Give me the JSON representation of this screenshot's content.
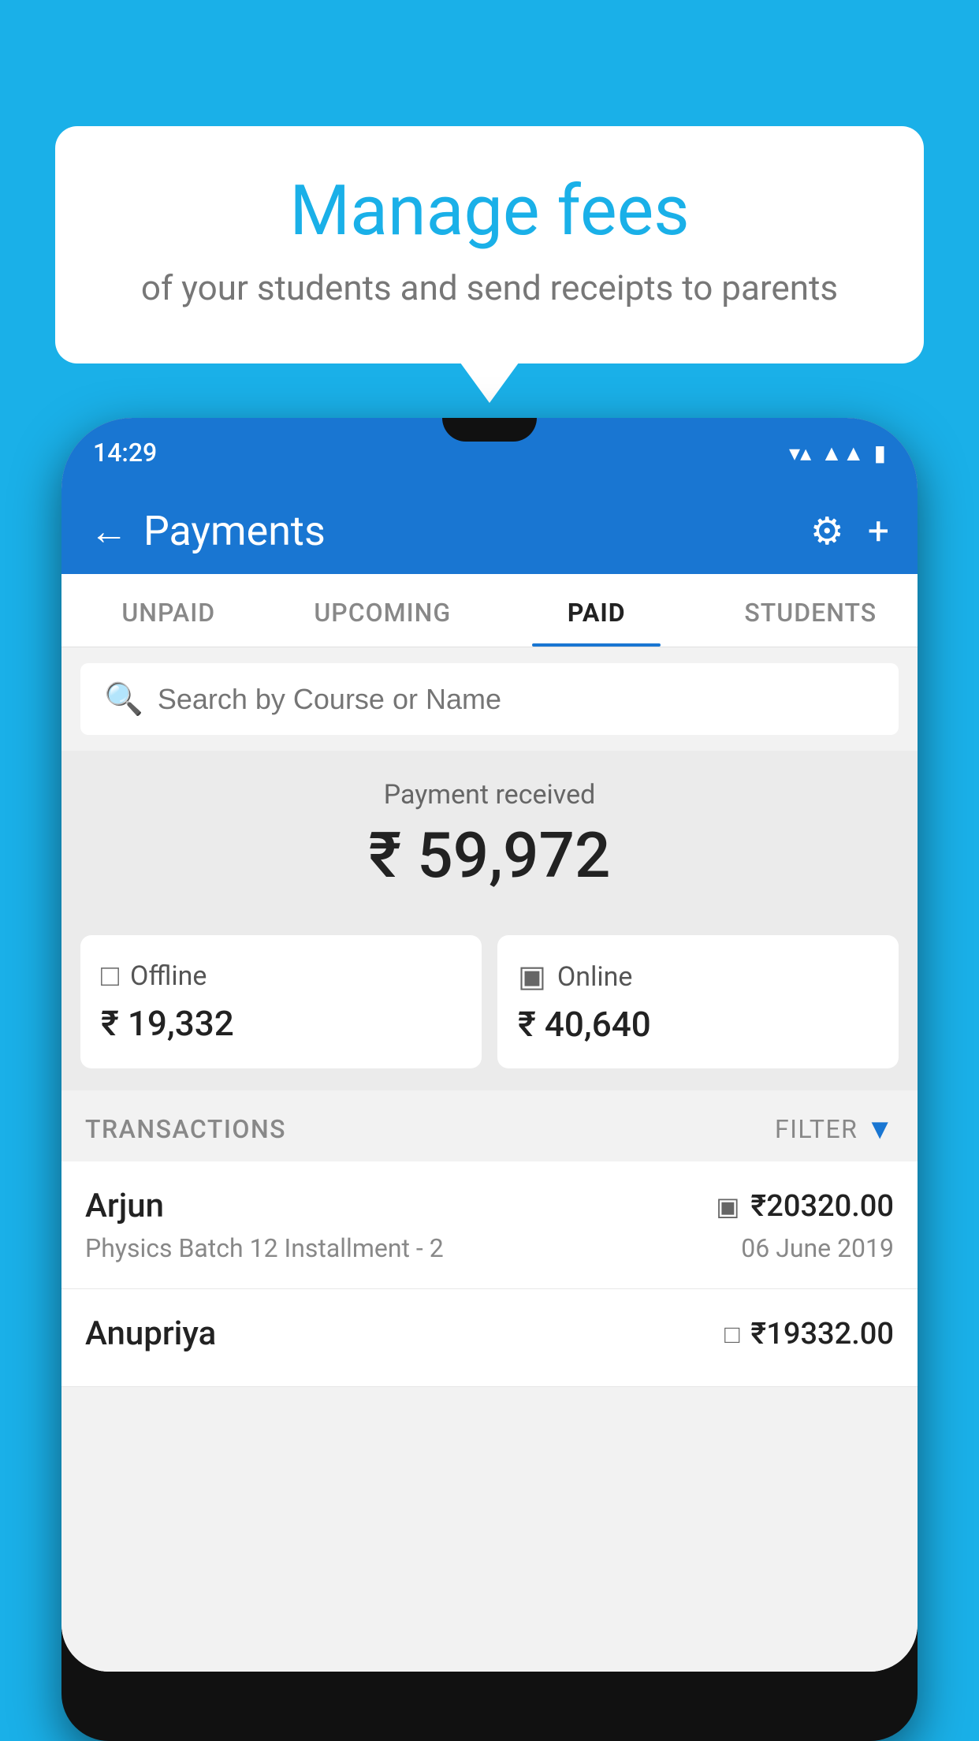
{
  "background_color": "#1ab0e8",
  "bubble": {
    "title": "Manage fees",
    "subtitle": "of your students and send receipts to parents"
  },
  "phone": {
    "status_time": "14:29",
    "header": {
      "title": "Payments",
      "back_label": "←",
      "gear_label": "⚙",
      "plus_label": "+"
    },
    "tabs": [
      {
        "label": "UNPAID",
        "active": false
      },
      {
        "label": "UPCOMING",
        "active": false
      },
      {
        "label": "PAID",
        "active": true
      },
      {
        "label": "STUDENTS",
        "active": false
      }
    ],
    "search": {
      "placeholder": "Search by Course or Name"
    },
    "payment_summary": {
      "label": "Payment received",
      "amount": "₹ 59,972",
      "offline_label": "Offline",
      "offline_amount": "₹ 19,332",
      "online_label": "Online",
      "online_amount": "₹ 40,640"
    },
    "transactions": {
      "header": "TRANSACTIONS",
      "filter_label": "FILTER",
      "rows": [
        {
          "name": "Arjun",
          "course": "Physics Batch 12 Installment - 2",
          "amount": "₹20320.00",
          "date": "06 June 2019",
          "type": "online"
        },
        {
          "name": "Anupriya",
          "course": "",
          "amount": "₹19332.00",
          "date": "",
          "type": "offline"
        }
      ]
    }
  }
}
